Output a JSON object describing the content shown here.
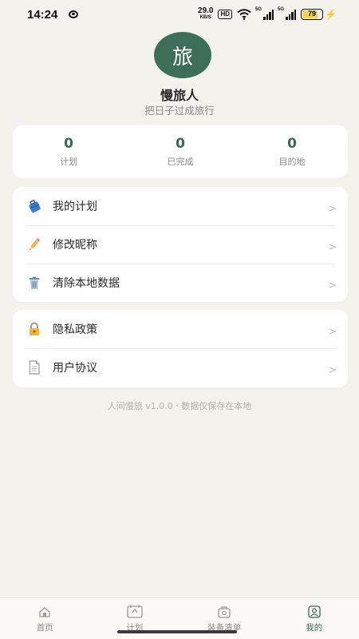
{
  "status_bar": {
    "time": "14:24",
    "net_speed": "29.0",
    "net_unit": "KB/S",
    "hd": "HD",
    "signal_label_1": "5G",
    "signal_label_2": "5G",
    "battery": "79",
    "battery_color": "#f3d44a",
    "charging_color": "#2fa84f"
  },
  "profile": {
    "avatar_char": "旅",
    "avatar_color": "#3c6e58",
    "nickname": "慢旅人",
    "motto": "把日子过成旅行"
  },
  "stats": [
    {
      "value": "0",
      "label": "计划"
    },
    {
      "value": "0",
      "label": "已完成"
    },
    {
      "value": "0",
      "label": "目的地"
    }
  ],
  "menu_group_1": [
    {
      "icon": "suitcase-icon",
      "label": "我的计划"
    },
    {
      "icon": "pencil-icon",
      "label": "修改昵称"
    },
    {
      "icon": "trash-icon",
      "label": "清除本地数据"
    }
  ],
  "menu_group_2": [
    {
      "icon": "lock-icon",
      "label": "隐私政策"
    },
    {
      "icon": "document-icon",
      "label": "用户协议"
    }
  ],
  "chevron": ">",
  "footer": {
    "version_text": "人间慢旅 v1.0.0 · 数据仅保存在本地"
  },
  "tabbar": {
    "active_index": 3,
    "accent_color": "#3a6b53",
    "tabs": [
      {
        "icon": "home-icon",
        "label": "首页"
      },
      {
        "icon": "plan-icon",
        "label": "计划"
      },
      {
        "icon": "gear-list-icon",
        "label": "装备清单"
      },
      {
        "icon": "profile-icon",
        "label": "我的"
      }
    ]
  }
}
